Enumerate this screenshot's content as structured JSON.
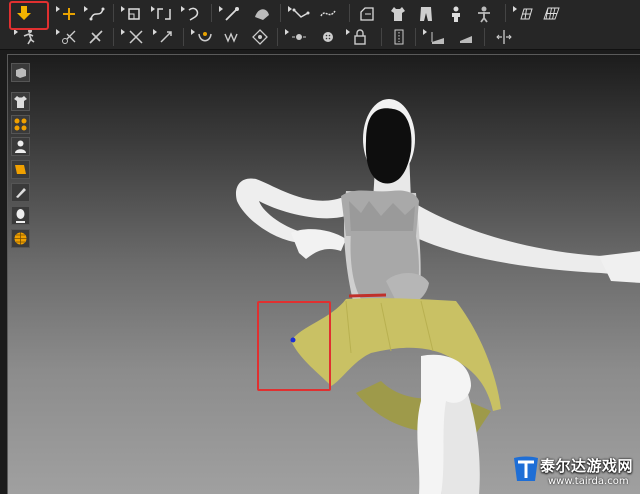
{
  "toolbar_top": {
    "tools": [
      "move-pin-tool-icon",
      "add-point-tool-icon",
      "edit-curve-tool-icon",
      "edit-pattern-tool-icon",
      "transform-tool-icon",
      "tack-tool-icon",
      "pin-tool-icon",
      "fold-tool-icon",
      "sewing-tool-icon",
      "stretch-tool-icon",
      "garment-tool-icon",
      "shirt-tool-icon",
      "avatar-tool-icon",
      "body-tool-icon",
      "grid-tool-icon",
      "mesh-tool-icon"
    ]
  },
  "toolbar_bottom": {
    "tools": [
      "run-tool-icon",
      "scissors-tool-icon",
      "cut-tool-icon",
      "cloth-tool-icon",
      "rotate-tool-icon",
      "anchor-tool-icon",
      "pattern-a-icon",
      "pattern-b-icon",
      "button-tool-icon",
      "buttonhole-tool-icon",
      "lock-tool-icon",
      "zipper-tool-icon",
      "puckering-tool-icon",
      "fabric-tool-icon",
      "align-tool-icon"
    ]
  },
  "sidebar": {
    "items": [
      "cube-view-icon",
      "shirt-view-icon",
      "points-view-icon",
      "avatar-view-icon",
      "texture-view-icon",
      "brush-view-icon",
      "face-view-icon",
      "globe-view-icon"
    ]
  },
  "viewport": {
    "background_top": "#1c1c1c",
    "background_bottom": "#a0a0a0",
    "garment_color": "#c9c164",
    "waist_color": "#c0302a",
    "pin_color": "#1a2fd6"
  },
  "highlight_color": "#e03030",
  "watermark": {
    "title": "泰尔达游戏网",
    "url": "www.tairda.com"
  }
}
